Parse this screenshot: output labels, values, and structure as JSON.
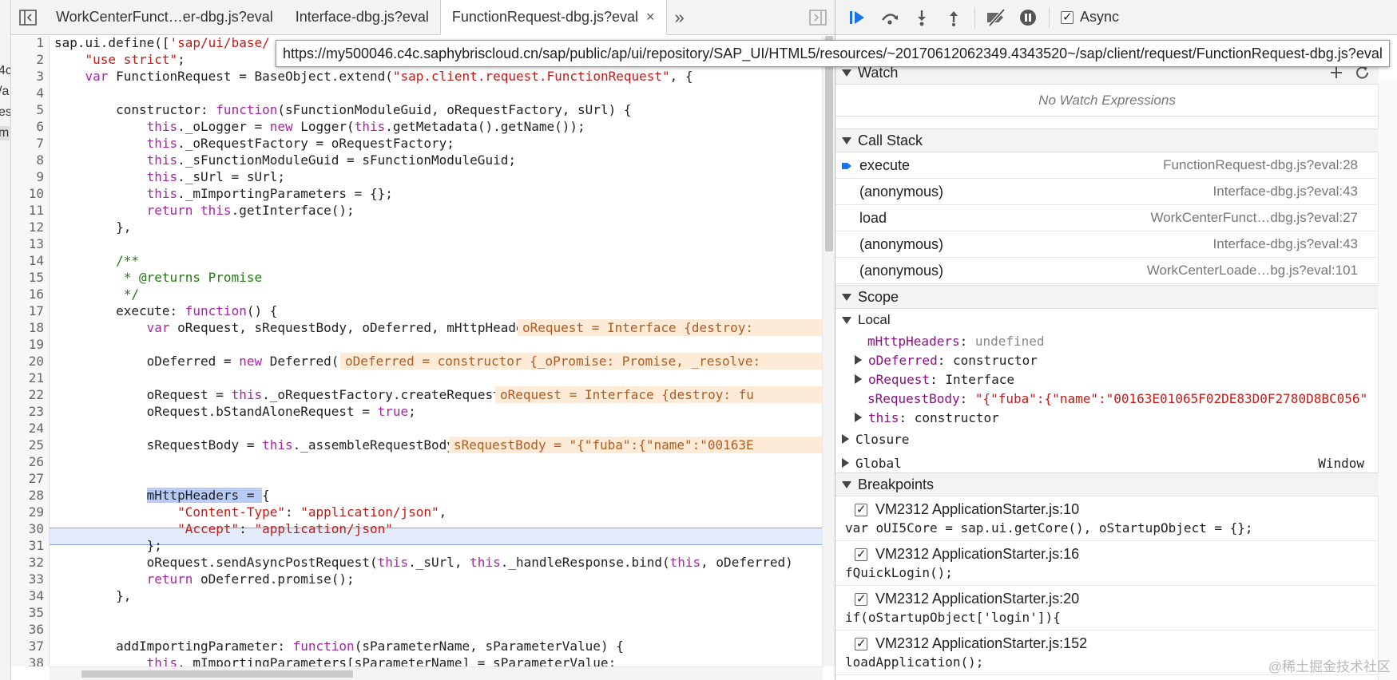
{
  "edge_fragments": [
    "4c",
    "/a",
    "es",
    "m"
  ],
  "editor": {
    "tabs": [
      {
        "label": "WorkCenterFunct…er-dbg.js?eval"
      },
      {
        "label": "Interface-dbg.js?eval"
      },
      {
        "label": "FunctionRequest-dbg.js?eval",
        "close": "×"
      }
    ],
    "more": "»",
    "current_line": "28",
    "lines": [
      {
        "n": "1",
        "parts": [
          {
            "t": "sap.ui.define(["
          },
          {
            "t": "'sap/ui/base/",
            "c": "s"
          }
        ]
      },
      {
        "n": "2",
        "parts": [
          {
            "t": "    "
          },
          {
            "t": "\"use strict\"",
            "c": "s"
          },
          {
            "t": ";"
          }
        ]
      },
      {
        "n": "3",
        "parts": [
          {
            "t": "    "
          },
          {
            "t": "var",
            "c": "k"
          },
          {
            "t": " FunctionRequest = BaseObject.extend("
          },
          {
            "t": "\"sap.client.request.FunctionRequest\"",
            "c": "s"
          },
          {
            "t": ", {"
          }
        ]
      },
      {
        "n": "4",
        "parts": []
      },
      {
        "n": "5",
        "parts": [
          {
            "t": "        constructor: "
          },
          {
            "t": "function",
            "c": "k"
          },
          {
            "t": "(sFunctionModuleGuid, oRequestFactory, sUrl) {"
          }
        ]
      },
      {
        "n": "6",
        "parts": [
          {
            "t": "            "
          },
          {
            "t": "this",
            "c": "k"
          },
          {
            "t": "._oLogger = "
          },
          {
            "t": "new",
            "c": "k"
          },
          {
            "t": " Logger("
          },
          {
            "t": "this",
            "c": "k"
          },
          {
            "t": ".getMetadata().getName());"
          }
        ]
      },
      {
        "n": "7",
        "parts": [
          {
            "t": "            "
          },
          {
            "t": "this",
            "c": "k"
          },
          {
            "t": "._oRequestFactory = oRequestFactory;"
          }
        ]
      },
      {
        "n": "8",
        "parts": [
          {
            "t": "            "
          },
          {
            "t": "this",
            "c": "k"
          },
          {
            "t": "._sFunctionModuleGuid = sFunctionModuleGuid;"
          }
        ]
      },
      {
        "n": "9",
        "parts": [
          {
            "t": "            "
          },
          {
            "t": "this",
            "c": "k"
          },
          {
            "t": "._sUrl = sUrl;"
          }
        ]
      },
      {
        "n": "10",
        "parts": [
          {
            "t": "            "
          },
          {
            "t": "this",
            "c": "k"
          },
          {
            "t": "._mImportingParameters = {};"
          }
        ]
      },
      {
        "n": "11",
        "parts": [
          {
            "t": "            "
          },
          {
            "t": "return",
            "c": "k"
          },
          {
            "t": " "
          },
          {
            "t": "this",
            "c": "k"
          },
          {
            "t": ".getInterface();"
          }
        ]
      },
      {
        "n": "12",
        "parts": [
          {
            "t": "        },"
          }
        ]
      },
      {
        "n": "13",
        "parts": []
      },
      {
        "n": "14",
        "parts": [
          {
            "t": "        "
          },
          {
            "t": "/**",
            "c": "c"
          }
        ]
      },
      {
        "n": "15",
        "parts": [
          {
            "t": "         "
          },
          {
            "t": "* @returns Promise",
            "c": "c"
          }
        ]
      },
      {
        "n": "16",
        "parts": [
          {
            "t": "         "
          },
          {
            "t": "*/",
            "c": "c"
          }
        ]
      },
      {
        "n": "17",
        "parts": [
          {
            "t": "        execute: "
          },
          {
            "t": "function",
            "c": "k"
          },
          {
            "t": "() {"
          }
        ]
      },
      {
        "n": "18",
        "parts": [
          {
            "t": "            "
          },
          {
            "t": "var",
            "c": "k"
          },
          {
            "t": " oRequest, sRequestBody, oDeferred, mHttpHeaders;"
          }
        ],
        "inline": "oRequest = Interface {destroy: "
      },
      {
        "n": "19",
        "parts": []
      },
      {
        "n": "20",
        "parts": [
          {
            "t": "            oDeferred = "
          },
          {
            "t": "new",
            "c": "k"
          },
          {
            "t": " Deferred();"
          }
        ],
        "inline": "oDeferred = constructor {_oPromise: Promise, _resolve: "
      },
      {
        "n": "21",
        "parts": []
      },
      {
        "n": "22",
        "parts": [
          {
            "t": "            oRequest = "
          },
          {
            "t": "this",
            "c": "k"
          },
          {
            "t": "._oRequestFactory.createRequest();"
          }
        ],
        "inline": "oRequest = Interface {destroy: fu"
      },
      {
        "n": "23",
        "parts": [
          {
            "t": "            oRequest.bStandAloneRequest = "
          },
          {
            "t": "true",
            "c": "k"
          },
          {
            "t": ";"
          }
        ]
      },
      {
        "n": "24",
        "parts": []
      },
      {
        "n": "25",
        "parts": [
          {
            "t": "            sRequestBody = "
          },
          {
            "t": "this",
            "c": "k"
          },
          {
            "t": "._assembleRequestBody();"
          }
        ],
        "inline": "sRequestBody = \"{\"fuba\":{\"name\":\"00163E"
      },
      {
        "n": "26",
        "parts": []
      },
      {
        "n": "27",
        "parts": []
      },
      {
        "n": "28",
        "parts": [
          {
            "t": "            "
          },
          {
            "t": "mHttpHeaders = ",
            "c": "sel"
          },
          {
            "t": "{"
          }
        ]
      },
      {
        "n": "29",
        "parts": [
          {
            "t": "                "
          },
          {
            "t": "\"Content-Type\"",
            "c": "s"
          },
          {
            "t": ": "
          },
          {
            "t": "\"application/json\"",
            "c": "s"
          },
          {
            "t": ","
          }
        ]
      },
      {
        "n": "30",
        "parts": [
          {
            "t": "                "
          },
          {
            "t": "\"Accept\"",
            "c": "s"
          },
          {
            "t": ": "
          },
          {
            "t": "\"application/json\"",
            "c": "s"
          }
        ]
      },
      {
        "n": "31",
        "parts": [
          {
            "t": "            };"
          }
        ]
      },
      {
        "n": "32",
        "parts": [
          {
            "t": "            oRequest.sendAsyncPostRequest("
          },
          {
            "t": "this",
            "c": "k"
          },
          {
            "t": "._sUrl, "
          },
          {
            "t": "this",
            "c": "k"
          },
          {
            "t": "._handleResponse.bind("
          },
          {
            "t": "this",
            "c": "k"
          },
          {
            "t": ", oDeferred)"
          }
        ]
      },
      {
        "n": "33",
        "parts": [
          {
            "t": "            "
          },
          {
            "t": "return",
            "c": "k"
          },
          {
            "t": " oDeferred.promise();"
          }
        ]
      },
      {
        "n": "34",
        "parts": [
          {
            "t": "        },"
          }
        ]
      },
      {
        "n": "35",
        "parts": []
      },
      {
        "n": "36",
        "parts": []
      },
      {
        "n": "37",
        "parts": [
          {
            "t": "        addImportingParameter: "
          },
          {
            "t": "function",
            "c": "k"
          },
          {
            "t": "(sParameterName, sParameterValue) {"
          }
        ]
      },
      {
        "n": "38",
        "parts": [
          {
            "t": "            "
          },
          {
            "t": "this",
            "c": "k"
          },
          {
            "t": "._mImportingParameters[sParameterName] = sParameterValue;"
          }
        ]
      }
    ]
  },
  "tooltip": "https://my500046.c4c.saphybriscloud.cn/sap/public/ap/ui/repository/SAP_UI/HTML5/resources/~20170612062349.4343520~/sap/client/request/FunctionRequest-dbg.js?eval",
  "debugger": {
    "async_label": "Async",
    "async_checked": true,
    "watch": {
      "title": "Watch",
      "empty": "No Watch Expressions"
    },
    "call_stack": {
      "title": "Call Stack",
      "frames": [
        {
          "name": "execute",
          "location": "FunctionRequest-dbg.js?eval:28",
          "current": true
        },
        {
          "name": "(anonymous)",
          "location": "Interface-dbg.js?eval:43"
        },
        {
          "name": "load",
          "location": "WorkCenterFunct…dbg.js?eval:27"
        },
        {
          "name": "(anonymous)",
          "location": "Interface-dbg.js?eval:43"
        },
        {
          "name": "(anonymous)",
          "location": "WorkCenterLoade…bg.js?eval:101"
        }
      ]
    },
    "scope": {
      "title": "Scope",
      "local_label": "Local",
      "local": [
        {
          "name": "mHttpHeaders",
          "value": "undefined",
          "kind": "undef",
          "expandable": false
        },
        {
          "name": "oDeferred",
          "value": "constructor",
          "kind": "obj",
          "expandable": true
        },
        {
          "name": "oRequest",
          "value": "Interface",
          "kind": "obj",
          "expandable": true
        },
        {
          "name": "sRequestBody",
          "value": "\"{\"fuba\":{\"name\":\"00163E01065F02DE83D0F2780D8BC056\"",
          "kind": "str",
          "expandable": false
        },
        {
          "name": "this",
          "value": "constructor",
          "kind": "obj",
          "expandable": true
        }
      ],
      "closure_label": "Closure",
      "global_label": "Global",
      "global_value": "Window"
    },
    "breakpoints": {
      "title": "Breakpoints",
      "items": [
        {
          "title": "VM2312 ApplicationStarter.js:10",
          "code": "var oUI5Core = sap.ui.getCore(), oStartupObject = {};"
        },
        {
          "title": "VM2312 ApplicationStarter.js:16",
          "code": "fQuickLogin();"
        },
        {
          "title": "VM2312 ApplicationStarter.js:20",
          "code": "if(oStartupObject['login']){"
        },
        {
          "title": "VM2312 ApplicationStarter.js:152",
          "code": "loadApplication();"
        }
      ]
    }
  },
  "watermark": "@稀土掘金技术社区",
  "colors": {
    "accent": "#1a73e8",
    "keyword": "#a626a4",
    "string": "#c41a16",
    "comment": "#237a12",
    "inline_bg": "#fdebd8"
  }
}
